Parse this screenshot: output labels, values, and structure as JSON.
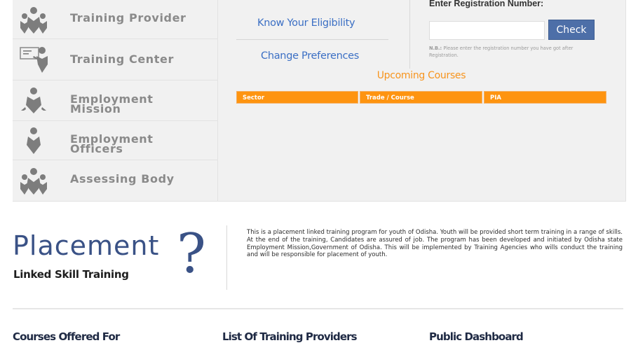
{
  "sidebar": {
    "items": [
      {
        "label_line1": "Training Provider",
        "label_line2": "",
        "icon": "group-icon"
      },
      {
        "label_line1": "Training Center",
        "label_line2": "",
        "icon": "presenter-icon"
      },
      {
        "label_line1": "Employment",
        "label_line2": "Mission",
        "icon": "person-arrows-icon"
      },
      {
        "label_line1": "Employment",
        "label_line2": "Officers",
        "icon": "person-icon"
      },
      {
        "label_line1": "Assessing Body",
        "label_line2": "",
        "icon": "group-icon"
      }
    ]
  },
  "links": {
    "know_eligibility": "Know Your Eligibility",
    "change_preferences": "Change Preferences"
  },
  "registration": {
    "label": "Enter Registration Number:",
    "input_value": "",
    "input_placeholder": "",
    "button_label": "Check",
    "note_prefix": "N.B.:",
    "note": "Please enter the registration number you have got after Registration."
  },
  "upcoming": {
    "title": "Upcoming Courses",
    "columns": [
      "Sector",
      "Trade / Course",
      "PIA"
    ],
    "rows": []
  },
  "placement": {
    "title": "Placement",
    "subtitle": "Linked Skill Training",
    "symbol": "?",
    "description": "This is a placement linked training program for youth of Odisha. Youth will be provided short term training in a range of skills. At the end of the training, Candidates are assured of job. The program has been developed and initiated by Odisha state Employment Mission,Government of Odisha. This will be implemented by Training Agencies who wills conduct the training and will be responsible for placement of youth."
  },
  "footer": {
    "headings": [
      "Courses Offered For",
      "List Of Training Providers",
      "Public Dashboard"
    ]
  },
  "colors": {
    "accent_orange": "#fe9410",
    "link_blue": "#3b6fc4",
    "button_blue": "#4d6fa8",
    "title_navy": "#3a5286",
    "icon_gray": "#7d7d7d"
  }
}
